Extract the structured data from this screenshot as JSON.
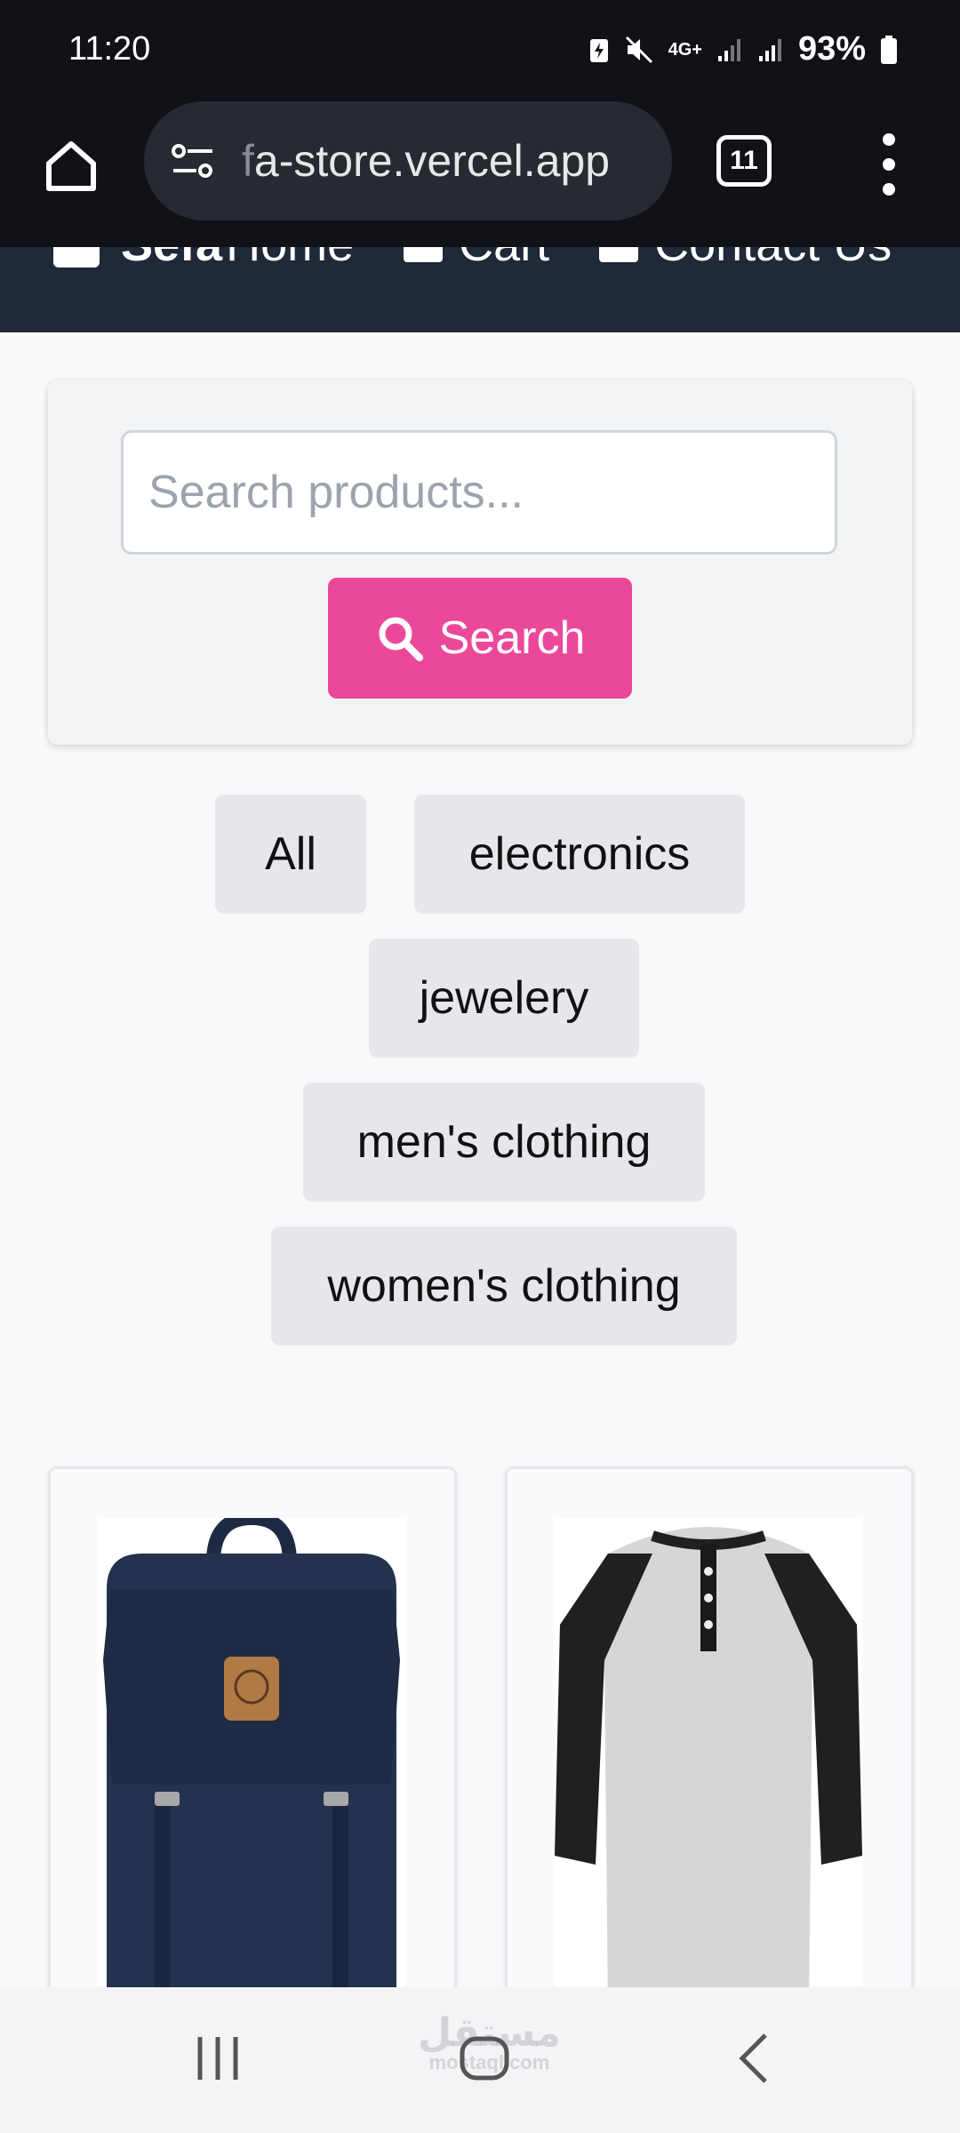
{
  "status_bar": {
    "time": "11:20",
    "network": "4G+",
    "battery": "93%",
    "icons": [
      "battery-saver-icon",
      "mute-icon",
      "network-4g-icon",
      "signal-icon",
      "signal-icon-2",
      "battery-icon"
    ]
  },
  "browser": {
    "url_faded": "f",
    "url": "a-store.vercel.app",
    "tab_count": "11"
  },
  "site_nav": {
    "brand": "Sefa",
    "links": [
      "Home",
      "Cart",
      "Contact Us"
    ]
  },
  "search": {
    "placeholder": "Search products...",
    "button_label": "Search"
  },
  "categories": [
    "All",
    "electronics",
    "jewelery",
    "men's clothing",
    "women's clothing"
  ],
  "products": [
    {
      "image": "navy-backpack",
      "alt": "backpack"
    },
    {
      "image": "raglan-henley-shirt",
      "alt": "shirt"
    }
  ],
  "watermark": {
    "text": "مستقل",
    "sub": "mostaql.com"
  },
  "colors": {
    "accent": "#ec4899",
    "navbar": "#1f2937",
    "chip": "#e5e7eb",
    "browser_chrome": "#101218"
  }
}
